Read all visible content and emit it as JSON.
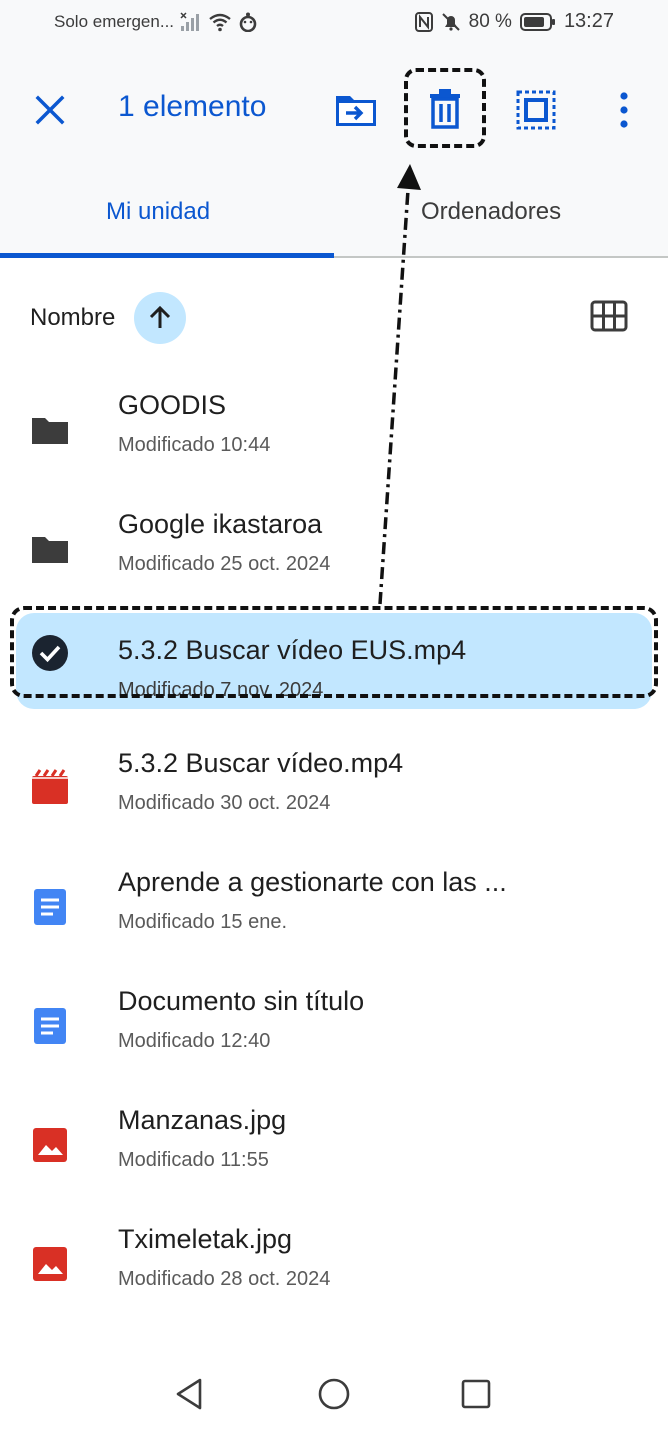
{
  "status_bar": {
    "carrier": "Solo emergen...",
    "battery": "80 %",
    "time": "13:27"
  },
  "app_bar": {
    "title": "1 elemento"
  },
  "tabs": [
    {
      "label": "Mi unidad",
      "active": true
    },
    {
      "label": "Ordenadores",
      "active": false
    }
  ],
  "sort": {
    "label": "Nombre"
  },
  "files": [
    {
      "name": "GOODIS",
      "meta": "Modificado 10:44",
      "icon": "folder-icon",
      "selected": false
    },
    {
      "name": "Google ikastaroa",
      "meta": "Modificado 25 oct. 2024",
      "icon": "folder-icon",
      "selected": false
    },
    {
      "name": "5.3.2 Buscar vídeo EUS.mp4",
      "meta": "Modificado 7 nov. 2024",
      "icon": "check-circle-icon",
      "selected": true
    },
    {
      "name": "5.3.2 Buscar vídeo.mp4",
      "meta": "Modificado 30 oct. 2024",
      "icon": "video-icon",
      "selected": false
    },
    {
      "name": "Aprende a gestionarte con las ...",
      "meta": "Modificado 15 ene.",
      "icon": "doc-icon",
      "selected": false
    },
    {
      "name": "Documento sin título",
      "meta": "Modificado 12:40",
      "icon": "doc-icon",
      "selected": false
    },
    {
      "name": "Manzanas.jpg",
      "meta": "Modificado 11:55",
      "icon": "image-icon",
      "selected": false
    },
    {
      "name": "Tximeletak.jpg",
      "meta": "Modificado 28 oct. 2024",
      "icon": "image-icon",
      "selected": false
    }
  ],
  "colors": {
    "accent": "#0b57d0",
    "selected_bg": "#c2e7ff",
    "video_red": "#d93025",
    "doc_blue": "#4285f4"
  }
}
